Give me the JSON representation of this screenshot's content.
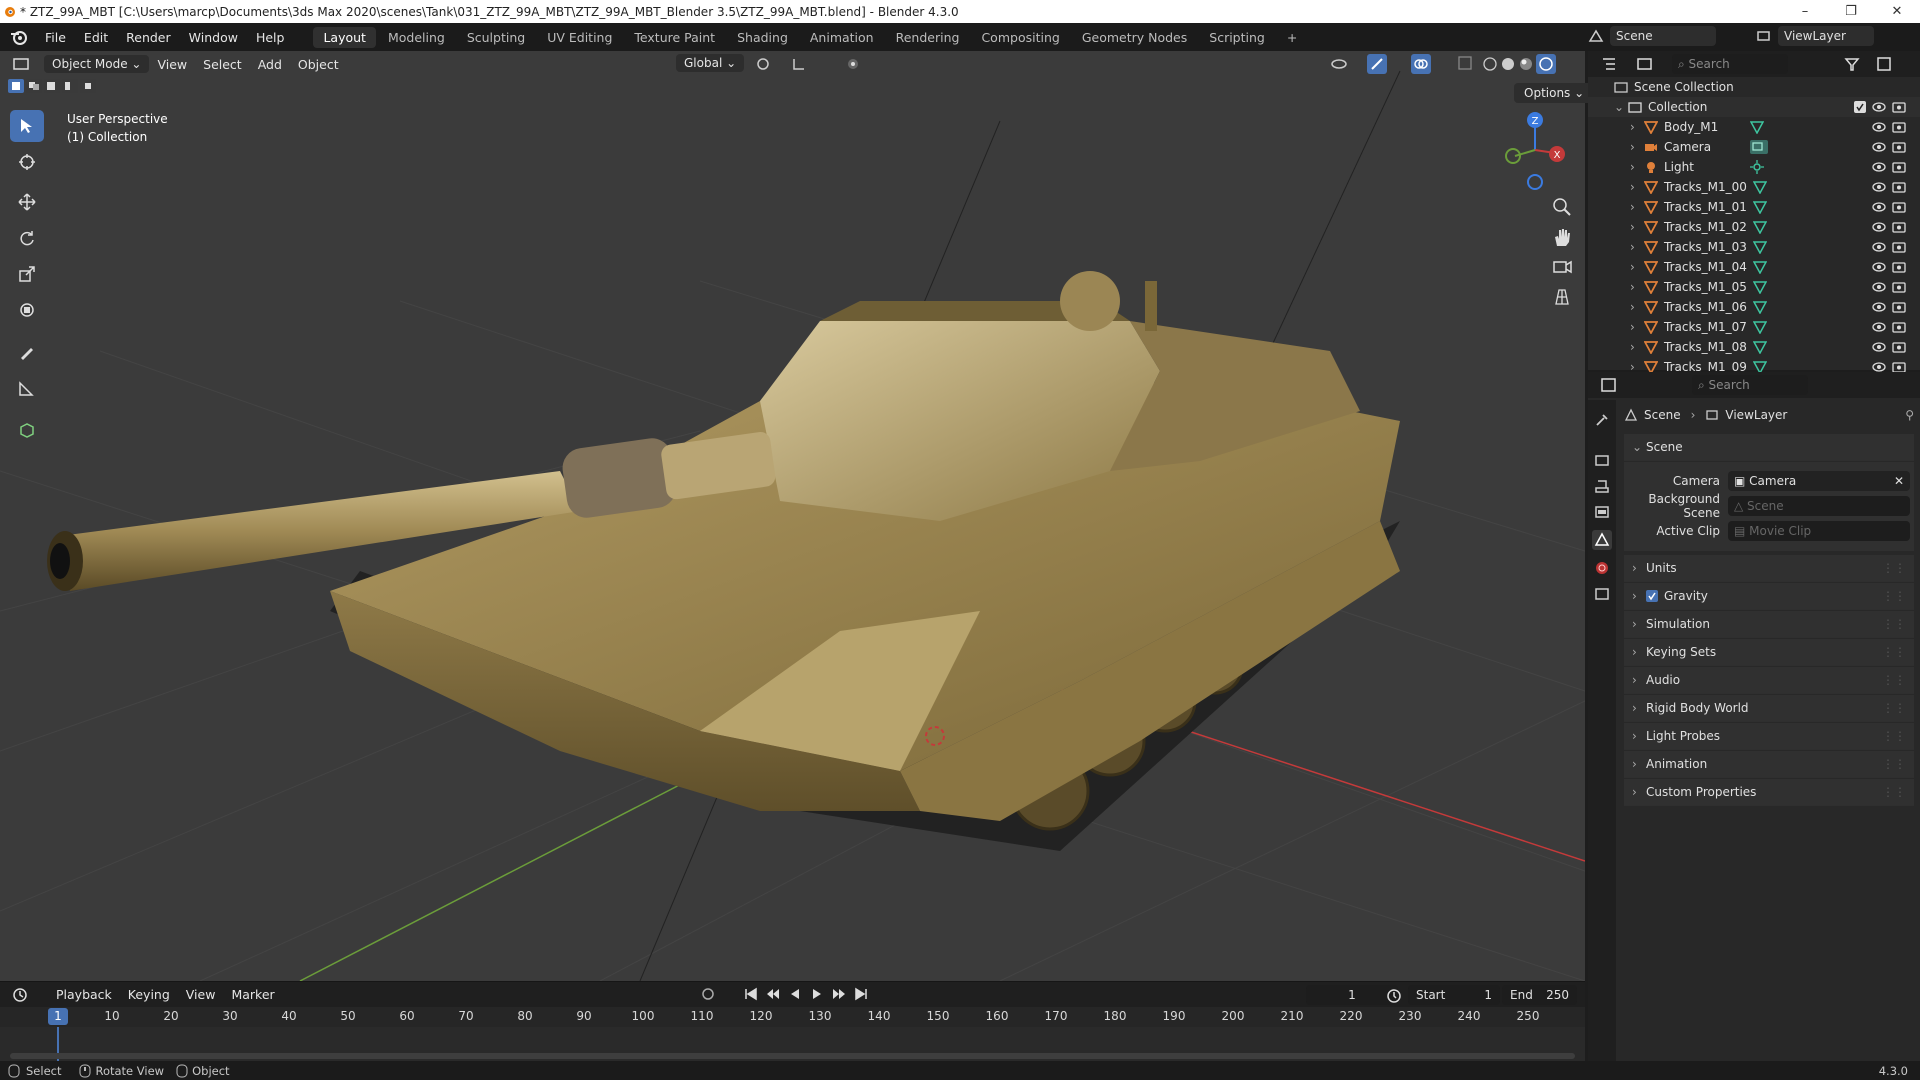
{
  "window": {
    "title": "* ZTZ_99A_MBT [C:\\Users\\marcp\\Documents\\3ds Max 2020\\scenes\\Tank\\031_ZTZ_99A_MBT\\ZTZ_99A_MBT_Blender 3.5\\ZTZ_99A_MBT.blend] - Blender 4.3.0",
    "minimize": "–",
    "maximize": "❐",
    "close": "✕"
  },
  "menus": [
    "File",
    "Edit",
    "Render",
    "Window",
    "Help"
  ],
  "workspaces": [
    "Layout",
    "Modeling",
    "Sculpting",
    "UV Editing",
    "Texture Paint",
    "Shading",
    "Animation",
    "Rendering",
    "Compositing",
    "Geometry Nodes",
    "Scripting"
  ],
  "active_workspace": "Layout",
  "add_workspace": "+",
  "scene_selector": "Scene",
  "viewlayer_selector": "ViewLayer",
  "viewport": {
    "mode": "Object Mode",
    "menus": [
      "View",
      "Select",
      "Add",
      "Object"
    ],
    "orientation": "Global",
    "options": "Options",
    "overlay_line1": "User Perspective",
    "overlay_line2": "(1) Collection",
    "gizmo_z": "Z",
    "gizmo_x": "X"
  },
  "outliner": {
    "search_placeholder": "Search",
    "scene_collection": "Scene Collection",
    "collection": "Collection",
    "items": [
      {
        "name": "Body_M1",
        "type": "mesh"
      },
      {
        "name": "Camera",
        "type": "camera"
      },
      {
        "name": "Light",
        "type": "light"
      },
      {
        "name": "Tracks_M1_00",
        "type": "mesh"
      },
      {
        "name": "Tracks_M1_01",
        "type": "mesh"
      },
      {
        "name": "Tracks_M1_02",
        "type": "mesh"
      },
      {
        "name": "Tracks_M1_03",
        "type": "mesh"
      },
      {
        "name": "Tracks_M1_04",
        "type": "mesh"
      },
      {
        "name": "Tracks_M1_05",
        "type": "mesh"
      },
      {
        "name": "Tracks_M1_06",
        "type": "mesh"
      },
      {
        "name": "Tracks_M1_07",
        "type": "mesh"
      },
      {
        "name": "Tracks_M1_08",
        "type": "mesh"
      },
      {
        "name": "Tracks_M1_09",
        "type": "mesh"
      }
    ]
  },
  "properties": {
    "search_placeholder": "Search",
    "breadcrumb_scene": "Scene",
    "breadcrumb_viewlayer": "ViewLayer",
    "scene_panel": "Scene",
    "camera_label": "Camera",
    "camera_value": "Camera",
    "bg_scene_label": "Background Scene",
    "bg_scene_placeholder": "Scene",
    "active_clip_label": "Active Clip",
    "active_clip_placeholder": "Movie Clip",
    "panels": [
      "Units",
      "Gravity",
      "Simulation",
      "Keying Sets",
      "Audio",
      "Rigid Body World",
      "Light Probes",
      "Animation",
      "Custom Properties"
    ],
    "gravity_checked": true
  },
  "timeline": {
    "menus": [
      "Playback",
      "Keying",
      "View",
      "Marker"
    ],
    "current_frame": "1",
    "start_label": "Start",
    "start_value": "1",
    "end_label": "End",
    "end_value": "250",
    "ruler": [
      "10",
      "20",
      "30",
      "40",
      "50",
      "60",
      "70",
      "80",
      "90",
      "100",
      "110",
      "120",
      "130",
      "140",
      "150",
      "160",
      "170",
      "180",
      "190",
      "200",
      "210",
      "220",
      "230",
      "240",
      "250"
    ],
    "playhead_label": "1"
  },
  "statusbar": {
    "select": "Select",
    "rotate": "Rotate View",
    "object": "Object",
    "version": "4.3.0"
  },
  "colors": {
    "accent": "#4772b3",
    "mesh_icon": "#e0803a",
    "tank": "#a08a55",
    "x_axis": "#c43a3a",
    "y_axis": "#6b9d3a"
  }
}
